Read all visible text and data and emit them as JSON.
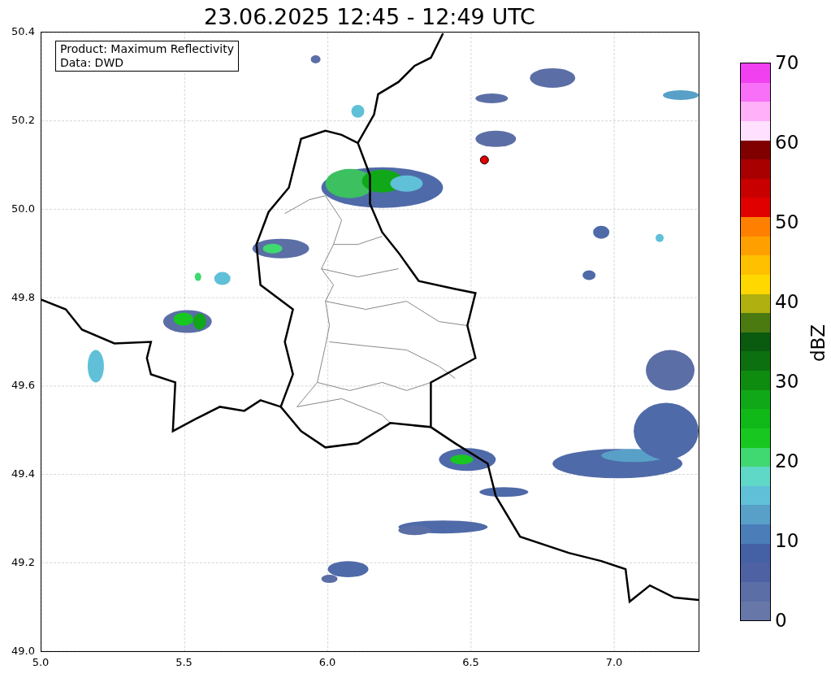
{
  "title": "23.06.2025 12:45 - 12:49 UTC",
  "info_box": [
    "Product: Maximum Reflectivity",
    "Data: DWD"
  ],
  "y_ticks": [
    "50.4",
    "50.2",
    "50.0",
    "49.8",
    "49.6",
    "49.4",
    "49.2",
    "49.0"
  ],
  "x_ticks": [
    "5.0",
    "5.5",
    "6.0",
    "6.5",
    "7.0"
  ],
  "colorbar": {
    "label": "dBZ",
    "ticks": [
      "70",
      "60",
      "50",
      "40",
      "30",
      "20",
      "10",
      "0"
    ],
    "bins": [
      {
        "color": "#f040f0"
      },
      {
        "color": "#f870f8"
      },
      {
        "color": "#ffb0f8"
      },
      {
        "color": "#ffe0ff"
      },
      {
        "color": "#800000"
      },
      {
        "color": "#a80000"
      },
      {
        "color": "#c80000"
      },
      {
        "color": "#e00000"
      },
      {
        "color": "#ff8000"
      },
      {
        "color": "#ffa000"
      },
      {
        "color": "#ffc000"
      },
      {
        "color": "#ffd800"
      },
      {
        "color": "#b0b010"
      },
      {
        "color": "#4a7a10"
      },
      {
        "color": "#0a5a10"
      },
      {
        "color": "#0c7010"
      },
      {
        "color": "#0e8c10"
      },
      {
        "color": "#10a818"
      },
      {
        "color": "#10b818"
      },
      {
        "color": "#18c820"
      },
      {
        "color": "#40d870"
      },
      {
        "color": "#60d8c8"
      },
      {
        "color": "#60c0d8"
      },
      {
        "color": "#58a0c8"
      },
      {
        "color": "#4b7eb8"
      },
      {
        "color": "#4561a6"
      },
      {
        "color": "#4e62a3"
      },
      {
        "color": "#5b6ea6"
      },
      {
        "color": "#6677a8"
      }
    ]
  }
}
